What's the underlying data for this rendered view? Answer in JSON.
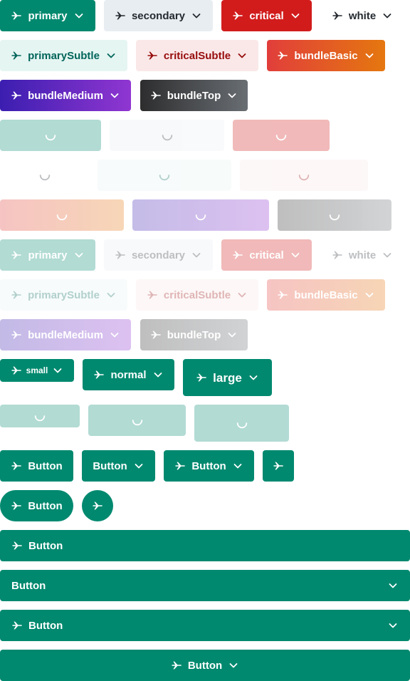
{
  "colors": {
    "primary": "#00896f",
    "secondary": "#e8edf1",
    "critical": "#d21c1c",
    "white": "#ffffff",
    "primarySubtle": "#e5f5f2",
    "criticalSubtle": "#fae8e8",
    "bundleBasic": [
      "#e13e3b",
      "#e5770f"
    ],
    "bundleMedium": [
      "#3b1eb0",
      "#9036d1"
    ],
    "bundleTop": [
      "#2d2d2e",
      "#696e73"
    ]
  },
  "icons": {
    "leading": "airplane-icon",
    "trailing": "chevron-down-icon",
    "loading": "spinner-icon"
  },
  "types": {
    "primary": "primary",
    "secondary": "secondary",
    "critical": "critical",
    "white": "white",
    "primarySubtle": "primarySubtle",
    "criticalSubtle": "criticalSubtle",
    "bundleBasic": "bundleBasic",
    "bundleMedium": "bundleMedium",
    "bundleTop": "bundleTop"
  },
  "sizes": {
    "small": "small",
    "normal": "normal",
    "large": "large"
  },
  "button_label": "Button"
}
